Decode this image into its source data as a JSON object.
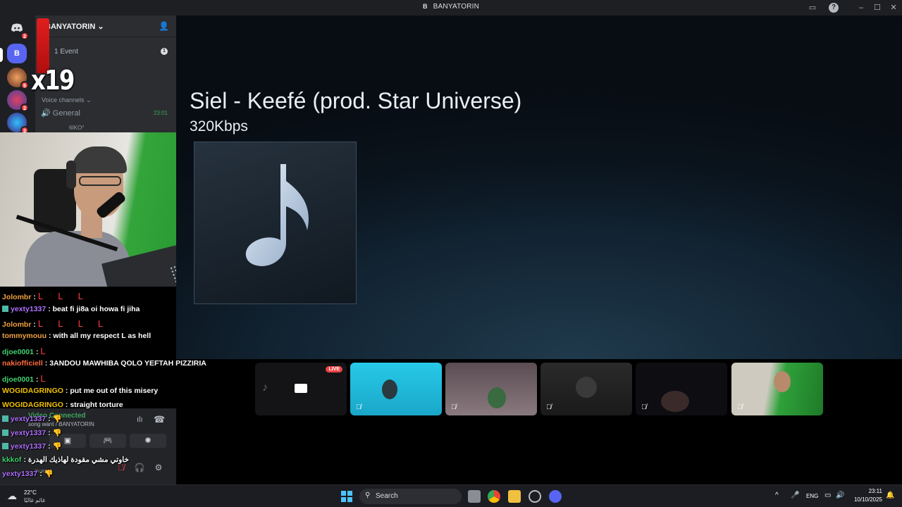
{
  "window": {
    "badge": "B",
    "title": "BANYATORIN"
  },
  "rail": {
    "home_badge": "2",
    "server_letter": "B",
    "badges": [
      "5",
      "2",
      "3"
    ]
  },
  "channels": {
    "server_name": "BANYATORIN",
    "event": "1 Event",
    "event_count": "1",
    "category": "Voice channels",
    "voice_channel": "General",
    "voice_time": "23:01",
    "member": "6IKO°"
  },
  "overlay": {
    "multiplier": "x19"
  },
  "main": {
    "song_title": "Siel - Keefé (prod. Star Universe)",
    "bitrate": "320Kbps"
  },
  "chat": [
    {
      "user": "Jolombr",
      "color": "#f0a040",
      "text": "",
      "Ls": "L L L"
    },
    {
      "user": "yexty1337",
      "color": "#b070ff",
      "text": "beat fi ji8a oi howa fi jiha",
      "Ls": "",
      "icon": true
    },
    {
      "user": "Jolombr",
      "color": "#f0a040",
      "text": "",
      "Ls": "L L L L"
    },
    {
      "user": "tommymouu",
      "color": "#f0a040",
      "text": "with all my respect L as hell",
      "Ls": ""
    },
    {
      "user": "djoe0001",
      "color": "#40d070",
      "text": "",
      "Ls": "L"
    },
    {
      "user": "nakiofficiell",
      "color": "#ff6a3d",
      "text": "3ANDOU MAWHIBA QOLO YEFTAH PIZZIRIA",
      "Ls": ""
    },
    {
      "user": "djoe0001",
      "color": "#40d070",
      "text": "",
      "Ls": "L"
    },
    {
      "user": "WOGIDAGRINGO",
      "color": "#f0c000",
      "text": "put me out of this misery",
      "Ls": ""
    },
    {
      "user": "WOGIDAGRINGO",
      "color": "#f0c000",
      "text": "straight torture",
      "Ls": ""
    },
    {
      "user": "yexty1337",
      "color": "#b070ff",
      "text": "👎",
      "Ls": "",
      "icon": true
    },
    {
      "user": "yexty1337",
      "color": "#b070ff",
      "text": "👎",
      "Ls": "",
      "icon": true
    },
    {
      "user": "yexty1337",
      "color": "#b070ff",
      "text": "👎",
      "Ls": "",
      "icon": true
    },
    {
      "user": "kkkof",
      "color": "#40d070",
      "text": "خاوتي مشي مقودة لهاذيك الهدرة",
      "Ls": ""
    },
    {
      "user": "yexty1337",
      "color": "#b070ff",
      "text": "👎",
      "Ls": ""
    }
  ],
  "voice": {
    "status": "Video Connected",
    "sub": "song want / BANYATORIN",
    "in_voice": "In voice"
  },
  "taskbar": {
    "temp": "22°C",
    "weather": "غائم غالبًا",
    "search": "Search",
    "lang": "ENG",
    "time": "23:11",
    "date": "10/10/2025"
  },
  "colors": {
    "accent": "#5865f2",
    "live": "#ed4245",
    "voice_green": "#3ba55d"
  },
  "icons": [
    "discord-icon",
    "add-member-icon",
    "speaker-icon",
    "music-note-icon",
    "mute-icon",
    "headphones-icon",
    "settings-icon",
    "windows-start-icon",
    "search-icon"
  ]
}
